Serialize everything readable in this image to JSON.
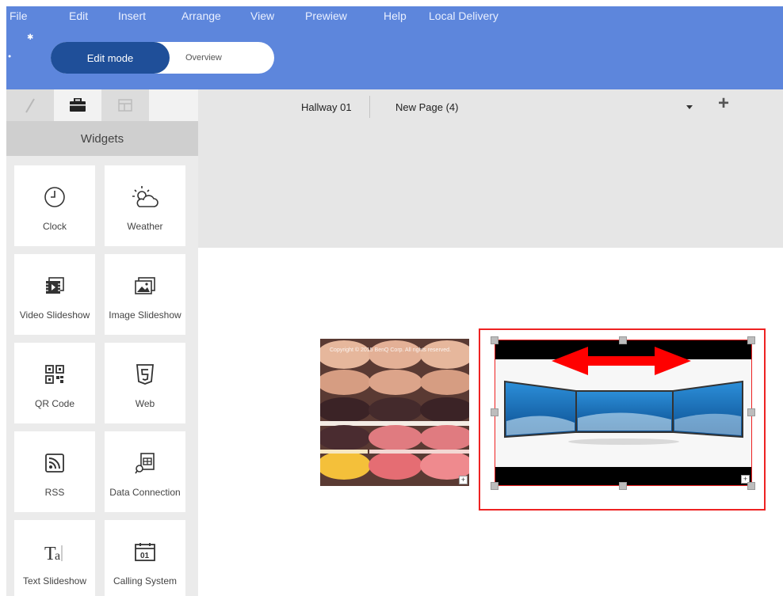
{
  "menu": {
    "items": [
      {
        "label": "File"
      },
      {
        "label": "Edit"
      },
      {
        "label": "Insert"
      },
      {
        "label": "Arrange"
      },
      {
        "label": "View"
      },
      {
        "label": "Prewiew"
      },
      {
        "label": "Help"
      },
      {
        "label": "Local Delivery"
      }
    ]
  },
  "mode": {
    "edit_label": "Edit mode",
    "overview_label": "Overview"
  },
  "left_panel": {
    "tabs": [
      {
        "icon": "pencil-icon"
      },
      {
        "icon": "briefcase-icon"
      },
      {
        "icon": "layout-icon"
      }
    ],
    "title": "Widgets",
    "widgets": [
      {
        "label": "Clock",
        "icon": "clock-icon"
      },
      {
        "label": "Weather",
        "icon": "weather-icon"
      },
      {
        "label": "Video Slideshow",
        "icon": "video-slideshow-icon"
      },
      {
        "label": "Image Slideshow",
        "icon": "image-slideshow-icon"
      },
      {
        "label": "QR Code",
        "icon": "qr-code-icon"
      },
      {
        "label": "Web",
        "icon": "html5-icon"
      },
      {
        "label": "RSS",
        "icon": "rss-icon"
      },
      {
        "label": "Data Connection",
        "icon": "data-connection-icon"
      },
      {
        "label": "Text Slideshow",
        "icon": "text-slideshow-icon"
      },
      {
        "label": "Calling System",
        "icon": "calling-system-icon"
      }
    ]
  },
  "pages": {
    "tabs": [
      {
        "label": "Hallway 01"
      },
      {
        "label": "New Page (4)"
      }
    ]
  },
  "canvas": {
    "image_copyright": "Copyright © 2015 BenQ Corp. All rights reserved."
  },
  "colors": {
    "topbar": "#5d86dc",
    "mode_active": "#1f4f99",
    "highlight": "#ee2222",
    "arrow": "#ff0000"
  }
}
